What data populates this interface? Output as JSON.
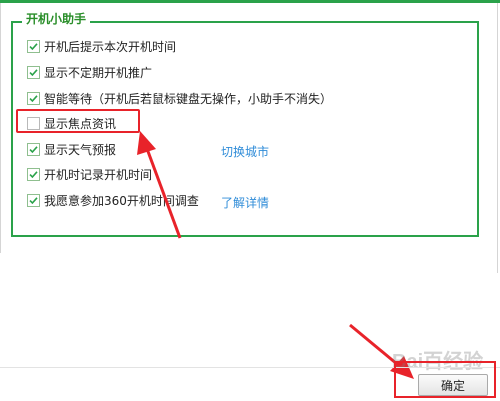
{
  "group": {
    "title": "开机小助手"
  },
  "options": [
    {
      "label": "开机后提示本次开机时间",
      "checked": true
    },
    {
      "label": "显示不定期开机推广",
      "checked": true
    },
    {
      "label": "智能等待（开机后若鼠标键盘无操作，小助手不消失）",
      "checked": true
    },
    {
      "label": "显示焦点资讯",
      "checked": false
    },
    {
      "label": "显示天气预报",
      "checked": true
    },
    {
      "label": "开机时记录开机时间",
      "checked": true
    },
    {
      "label": "我愿意参加360开机时间调查",
      "checked": true
    }
  ],
  "links": {
    "switch_city": "切换城市",
    "learn_more": "了解详情"
  },
  "footer": {
    "ok_label": "确定"
  },
  "watermark": {
    "text": "Bai百经验"
  },
  "colors": {
    "accent": "#2aa24a",
    "annotation": "#e8232a",
    "link": "#2f8cd8"
  }
}
